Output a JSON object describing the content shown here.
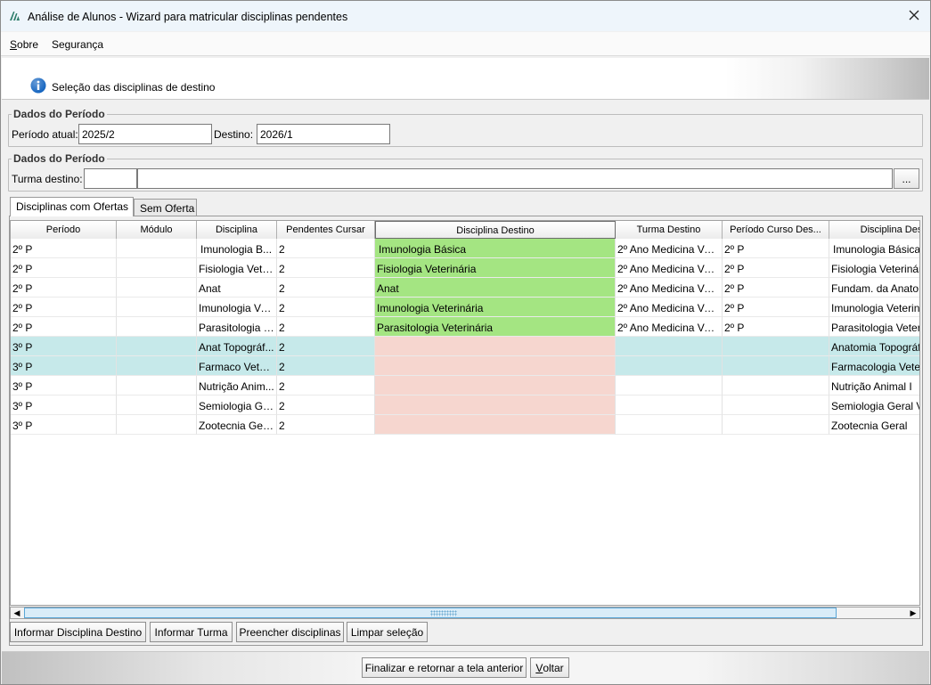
{
  "window": {
    "title": "Análise de Alunos - Wizard para matricular disciplinas pendentes"
  },
  "menu": {
    "items": [
      {
        "first": "S",
        "rest": "obre"
      },
      {
        "label": "Segurança"
      }
    ]
  },
  "banner": {
    "text": "Seleção das disciplinas de destino"
  },
  "periodo_group": {
    "legend": "Dados do Período",
    "atual_label": "Período atual:",
    "atual_value": "2025/2",
    "destino_label": "Destino:",
    "destino_value": "2026/1"
  },
  "turma_group": {
    "legend": "Dados do Período",
    "turma_label": "Turma destino:",
    "turma_code": "",
    "turma_name": "",
    "browse_label": "..."
  },
  "tabs": [
    {
      "label": "Disciplinas com Ofertas",
      "active": true
    },
    {
      "label": "Sem Oferta",
      "active": false
    }
  ],
  "table": {
    "columns": [
      "Período",
      "Módulo",
      "Disciplina",
      "Pendentes Cursar",
      "Disciplina Destino",
      "Turma Destino",
      "Período Curso Des...",
      "Disciplina Des"
    ],
    "rows": [
      {
        "periodo": "2º P",
        "modulo": "",
        "disciplina": "Imunologia B...",
        "pendentes": "2",
        "destino": "Imunologia Básica",
        "turma": "2º Ano Medicina Vet...",
        "periodo_curso": "2º P",
        "disc_des": "Imunologia Básica",
        "status": "ok"
      },
      {
        "periodo": "2º P",
        "modulo": "",
        "disciplina": "Fisiologia Vete...",
        "pendentes": "2",
        "destino": "Fisiologia Veterinária",
        "turma": "2º Ano Medicina Vet...",
        "periodo_curso": "2º P",
        "disc_des": "Fisiologia Veterinár",
        "status": "ok"
      },
      {
        "periodo": "2º P",
        "modulo": "",
        "disciplina": "Anat",
        "pendentes": "2",
        "destino": "Anat",
        "turma": "2º Ano Medicina Vet...",
        "periodo_curso": "2º P",
        "disc_des": "Fundam. da Anatom",
        "status": "ok"
      },
      {
        "periodo": "2º P",
        "modulo": "",
        "disciplina": "Imunologia Ve...",
        "pendentes": "2",
        "destino": "Imunologia Veterinária",
        "turma": "2º Ano Medicina Vet...",
        "periodo_curso": "2º P",
        "disc_des": "Imunologia Veterin",
        "status": "ok"
      },
      {
        "periodo": "2º P",
        "modulo": "",
        "disciplina": "Parasitologia V...",
        "pendentes": "2",
        "destino": "Parasitologia Veterinária",
        "turma": "2º Ano Medicina Vet...",
        "periodo_curso": "2º P",
        "disc_des": "Parasitologia Veteri",
        "status": "ok"
      },
      {
        "periodo": "3º P",
        "modulo": "",
        "disciplina": "Anat Topográf...",
        "pendentes": "2",
        "destino": "",
        "turma": "",
        "periodo_curso": "",
        "disc_des": "Anatomia Topográf",
        "status": "selected"
      },
      {
        "periodo": "3º P",
        "modulo": "",
        "disciplina": "Farmaco Veter...",
        "pendentes": "2",
        "destino": "",
        "turma": "",
        "periodo_curso": "",
        "disc_des": "Farmacologia Veter",
        "status": "selected"
      },
      {
        "periodo": "3º P",
        "modulo": "",
        "disciplina": "Nutrição Anim...",
        "pendentes": "2",
        "destino": "",
        "turma": "",
        "periodo_curso": "",
        "disc_des": "Nutrição Animal I",
        "status": "missing"
      },
      {
        "periodo": "3º P",
        "modulo": "",
        "disciplina": "Semiologia Ge...",
        "pendentes": "2",
        "destino": "",
        "turma": "",
        "periodo_curso": "",
        "disc_des": "Semiologia Geral Ve",
        "status": "missing"
      },
      {
        "periodo": "3º P",
        "modulo": "",
        "disciplina": "Zootecnia Geral",
        "pendentes": "2",
        "destino": "",
        "turma": "",
        "periodo_curso": "",
        "disc_des": "Zootecnia Geral",
        "status": "missing"
      }
    ]
  },
  "actions": {
    "informar_disciplina": "Informar Disciplina Destino",
    "informar_turma": "Informar Turma",
    "preencher": "Preencher disciplinas",
    "limpar": "Limpar seleção"
  },
  "footer": {
    "finalizar": "Finalizar e retornar a tela anterior",
    "voltar_first": "V",
    "voltar_rest": "oltar"
  },
  "colors": {
    "destino_ok": "#a4e582",
    "destino_missing": "#f6d6cf",
    "row_selected": "#c6e9ea",
    "info_icon": "#1565c0",
    "app_icon": "#2e7d6b"
  },
  "icons": {
    "app": "app-logo-icon",
    "close": "close-icon",
    "info": "info-icon",
    "scroll_left": "arrow-left-icon",
    "scroll_right": "arrow-right-icon"
  }
}
